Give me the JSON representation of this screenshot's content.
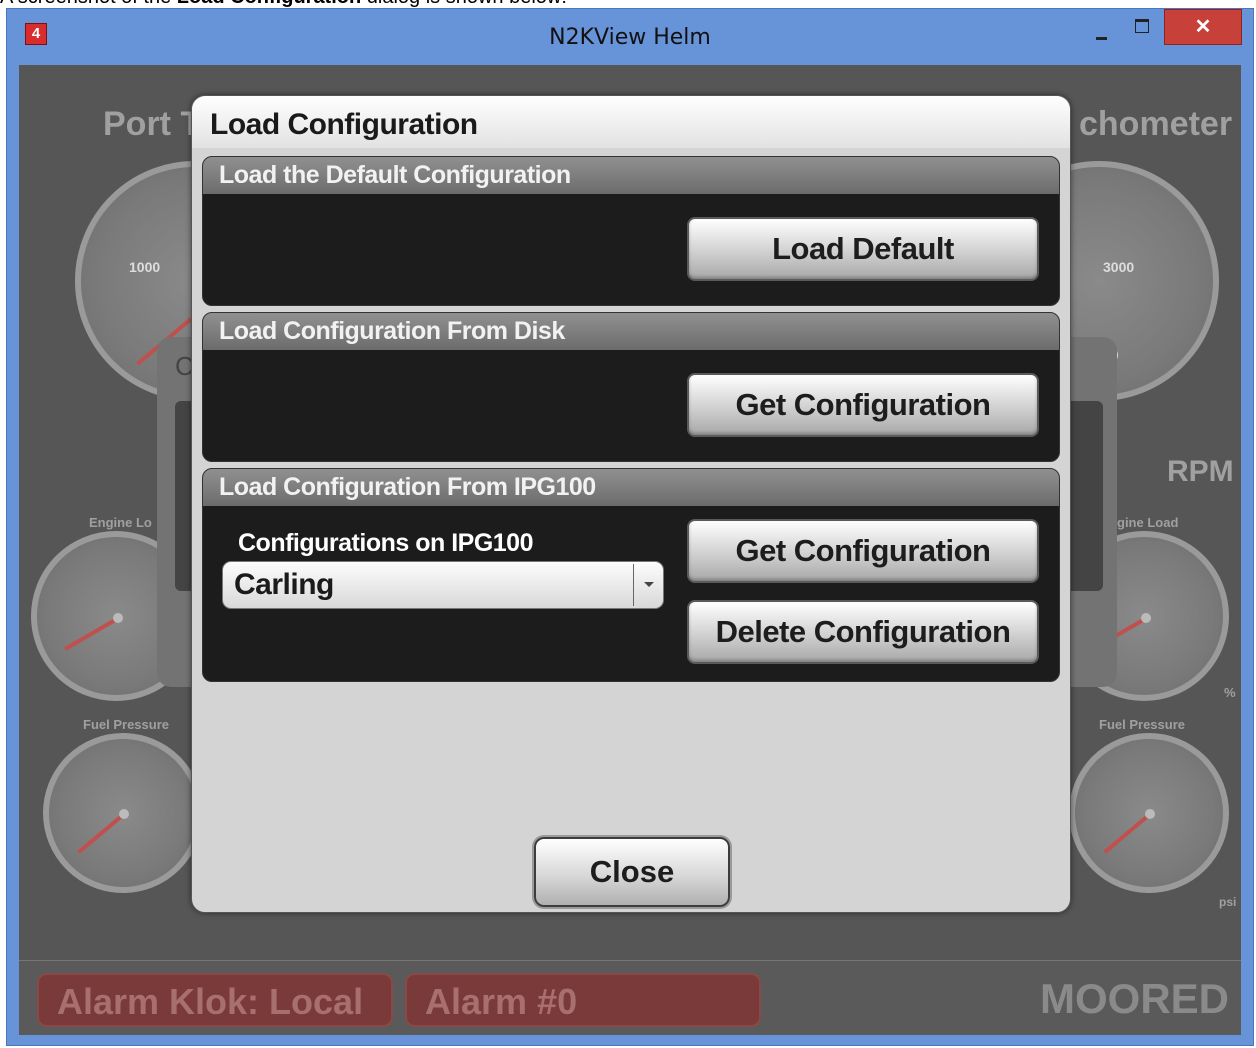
{
  "caption": {
    "prefix": "A screenshot of the",
    "bold": "Load Configuration",
    "suffix": "dialog is shown below:"
  },
  "window": {
    "title": "N2KView Helm",
    "app_icon_glyph": "4",
    "close_glyph": "✕"
  },
  "dashboard": {
    "port_label": "Port T",
    "tach_label": "chometer",
    "rpm_label": "RPM",
    "engine_load_left": "Engine Lo",
    "engine_load_right": "gine Load",
    "fuel_pressure_left": "Fuel Pressure",
    "fuel_pressure_right": "Fuel Pressure",
    "gauge_left_value": "1000",
    "gauge_right_value": "3000",
    "gauge_right_value2": "00",
    "percent_unit": "%",
    "psi_unit": "psi",
    "bg_dialog_letter": "C",
    "alarm1": "Alarm Klok: Local",
    "alarm2": "Alarm #0",
    "status": "MOORED"
  },
  "dialog": {
    "title": "Load Configuration",
    "sections": [
      {
        "header": "Load the Default Configuration",
        "button": "Load Default"
      },
      {
        "header": "Load Configuration From Disk",
        "button": "Get Configuration"
      },
      {
        "header": "Load Configuration From IPG100",
        "sub_label": "Configurations on IPG100",
        "select_value": "Carling",
        "button": "Get Configuration",
        "button2": "Delete Configuration"
      }
    ],
    "close_button": "Close"
  },
  "colors": {
    "titlebar": "#6793d8",
    "close_red": "#c7403a",
    "panel_bg": "#1c1c1c",
    "dialog_bg": "#d4d4d4"
  }
}
